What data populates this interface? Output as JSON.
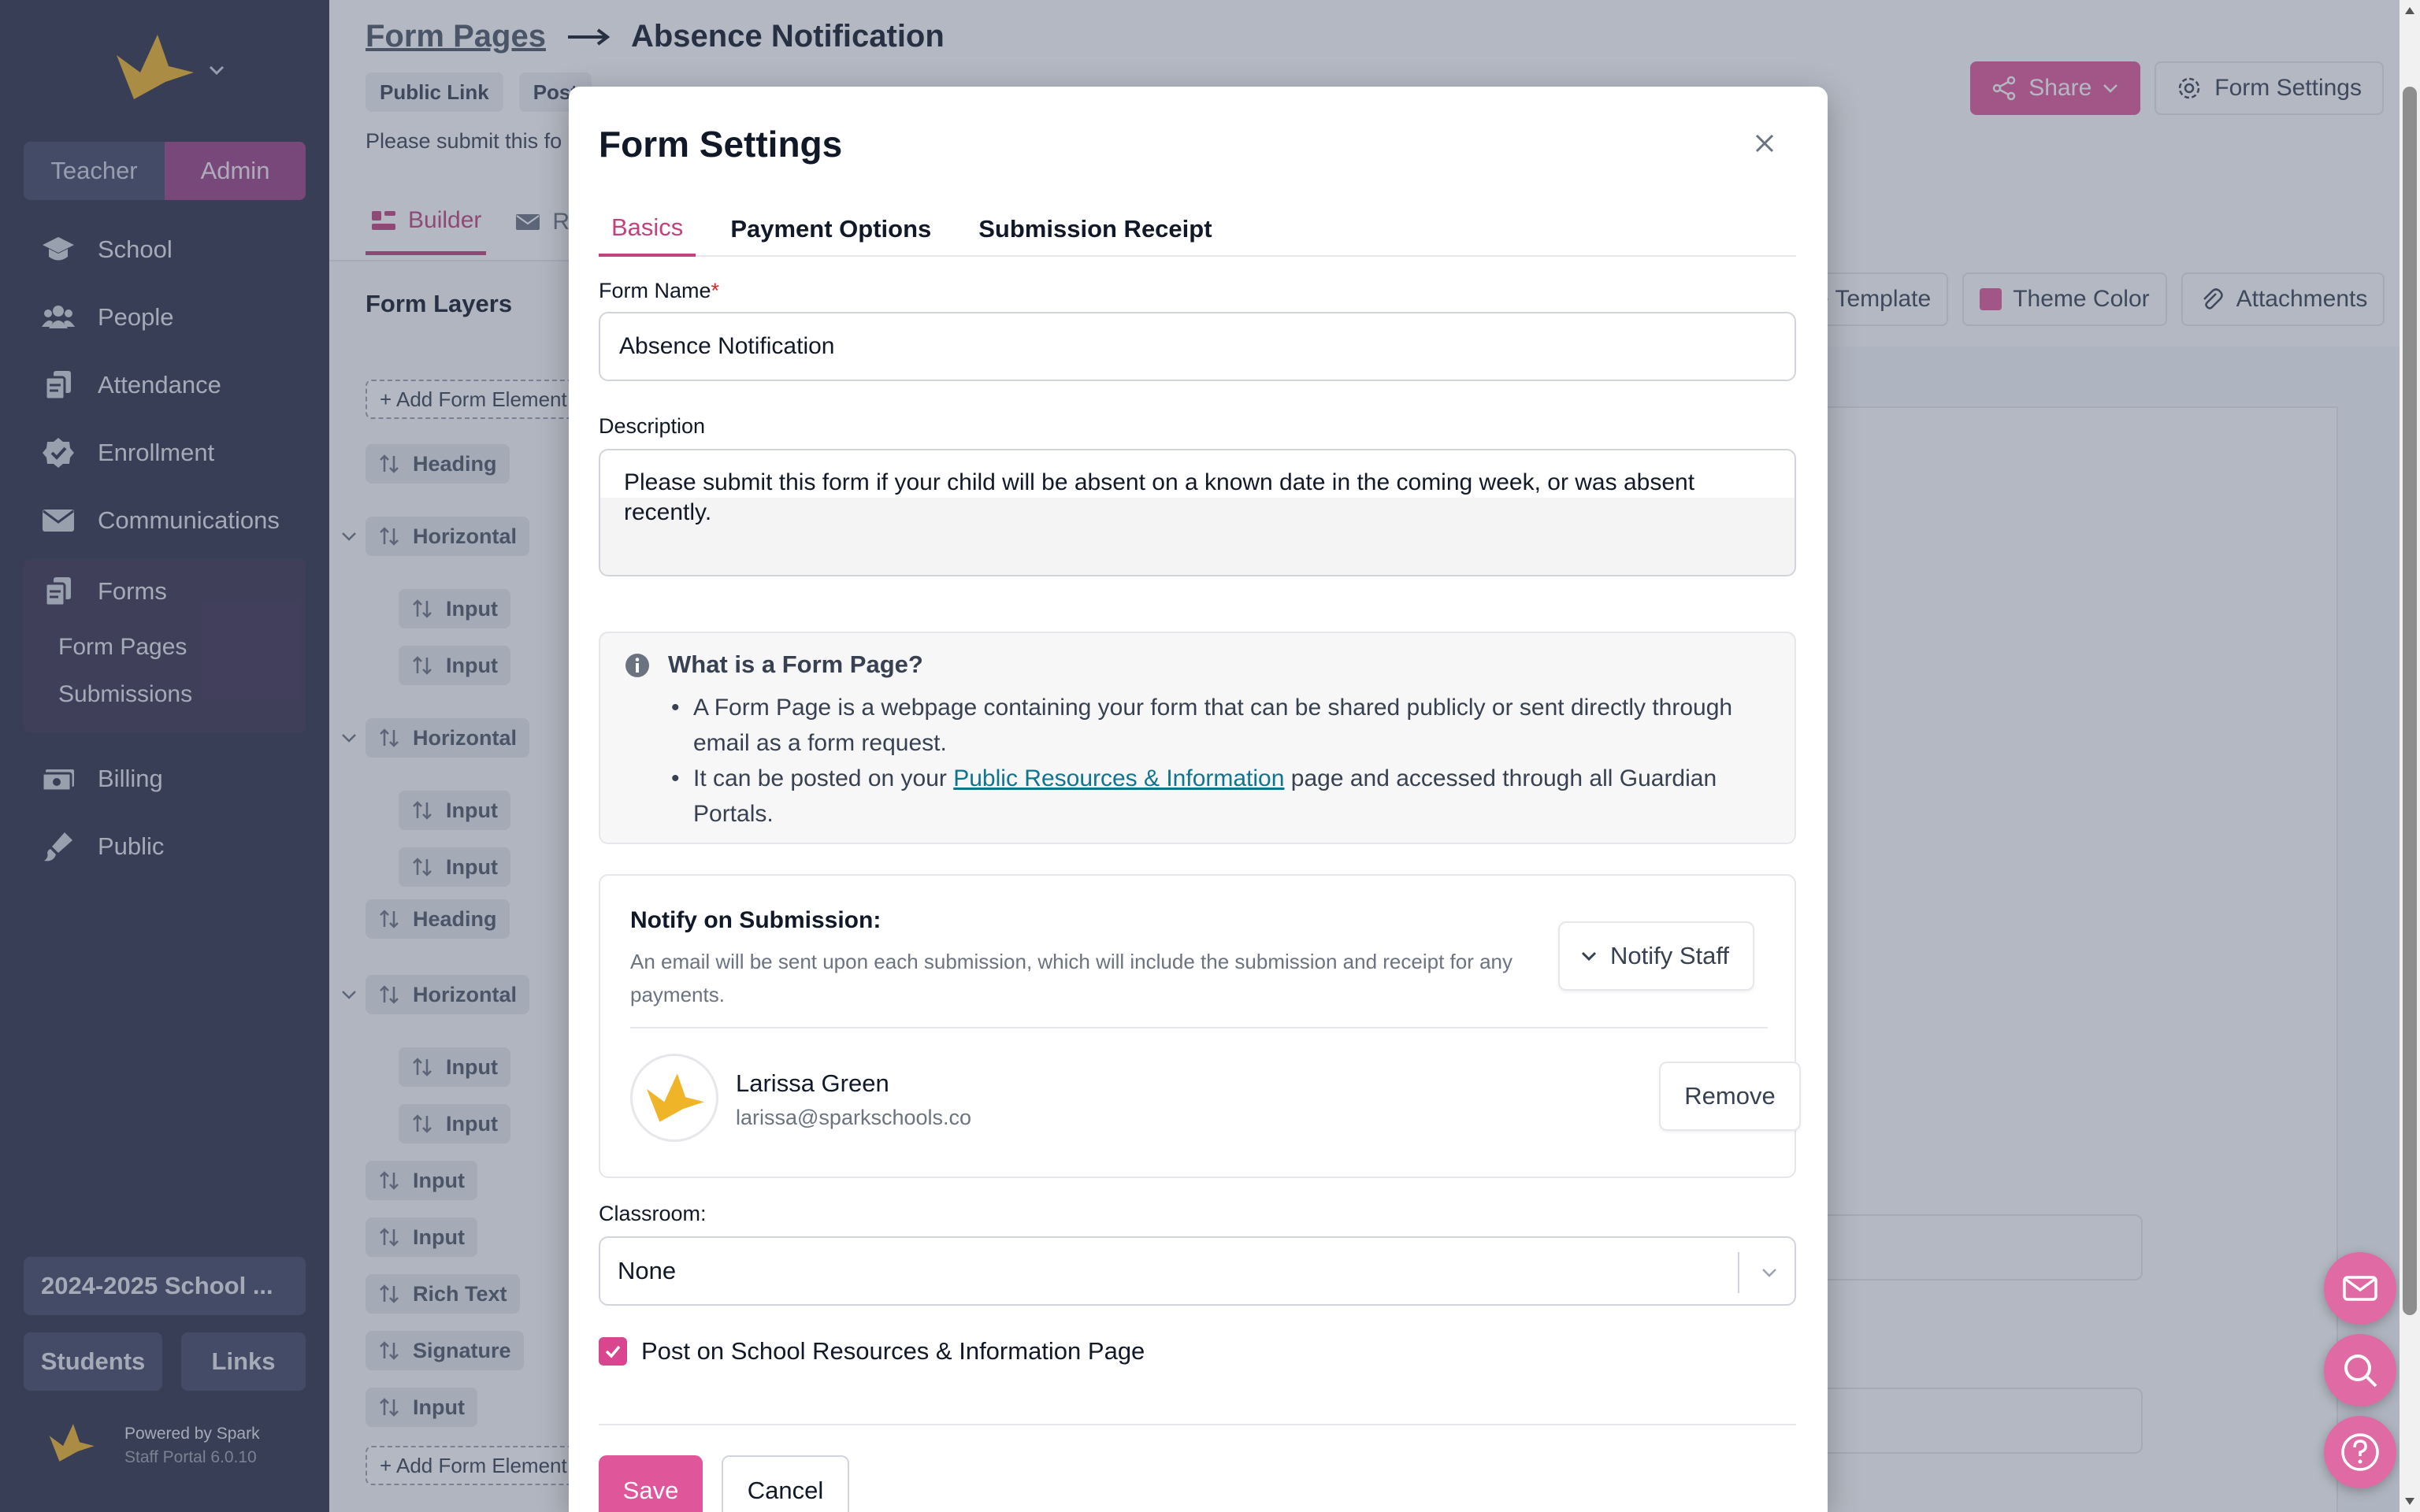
{
  "sidebar": {
    "roles": [
      {
        "label": "Teacher"
      },
      {
        "label": "Admin"
      }
    ],
    "nav": [
      {
        "label": "School",
        "icon": "graduation-cap-icon"
      },
      {
        "label": "People",
        "icon": "users-icon"
      },
      {
        "label": "Attendance",
        "icon": "clipboard-icon"
      },
      {
        "label": "Enrollment",
        "icon": "badge-check-icon"
      },
      {
        "label": "Communications",
        "icon": "envelope-icon"
      }
    ],
    "forms": {
      "label": "Forms",
      "icon": "forms-icon",
      "sub": [
        {
          "label": "Form Pages"
        },
        {
          "label": "Submissions"
        }
      ]
    },
    "nav_after": [
      {
        "label": "Billing",
        "icon": "money-icon"
      },
      {
        "label": "Public",
        "icon": "brush-icon"
      }
    ],
    "school_year": "2024-2025 School ...",
    "students_label": "Students",
    "links_label": "Links",
    "powered_by": "Powered by Spark",
    "version": "Staff Portal 6.0.10"
  },
  "header": {
    "breadcrumb_link": "Form Pages",
    "breadcrumb_current": "Absence Notification",
    "chips": [
      "Public Link",
      "Post"
    ],
    "description_preview": "Please submit this fo",
    "tabs": [
      {
        "label": "Builder",
        "icon": "builder-icon"
      },
      {
        "label": "R",
        "icon": "envelope-icon"
      }
    ],
    "share_label": "Share",
    "form_settings_label": "Form Settings"
  },
  "builder": {
    "layers_title": "Form Layers",
    "add_element_label": "+ Add Form Element",
    "toolbar": {
      "template_label": "ce Template",
      "theme_label": "Theme Color",
      "theme_color": "#e0569a",
      "attachments_label": "Attachments"
    },
    "layers": [
      {
        "label": "Heading"
      },
      {
        "label": "Horizontal"
      },
      {
        "label": "Input"
      },
      {
        "label": "Input"
      },
      {
        "label": "Horizontal"
      },
      {
        "label": "Input"
      },
      {
        "label": "Input"
      },
      {
        "label": "Heading"
      },
      {
        "label": "Horizontal"
      },
      {
        "label": "Input"
      },
      {
        "label": "Input"
      },
      {
        "label": "Input"
      },
      {
        "label": "Input"
      },
      {
        "label": "Rich Text"
      },
      {
        "label": "Signature"
      },
      {
        "label": "Input"
      }
    ]
  },
  "modal": {
    "title": "Form Settings",
    "tabs": [
      {
        "label": "Basics"
      },
      {
        "label": "Payment Options"
      },
      {
        "label": "Submission Receipt"
      }
    ],
    "form_name_label": "Form Name",
    "required_mark": "*",
    "form_name_value": "Absence Notification",
    "description_label": "Description",
    "description_value": "Please submit this form if your child will be absent on a known date in the coming week, or was absent recently.",
    "info": {
      "title": "What is a Form Page?",
      "bullet1": "A Form Page is a webpage containing your form that can be shared publicly or sent directly through email as a form request.",
      "bullet2_before": "It can be posted on your ",
      "bullet2_link": "Public Resources & Information",
      "bullet2_after": " page and accessed through all Guardian Portals."
    },
    "notify": {
      "title": "Notify on Submission:",
      "help": "An email will be sent upon each submission, which will include the submission and receipt for any payments.",
      "button_label": "Notify Staff",
      "staff": {
        "name": "Larissa Green",
        "email": "larissa@sparkschools.co"
      },
      "remove_label": "Remove"
    },
    "classroom_label": "Classroom:",
    "classroom_value": "None",
    "post_checkbox_label": "Post on School Resources & Information Page",
    "post_checked": true,
    "save_label": "Save",
    "cancel_label": "Cancel"
  },
  "colors": {
    "accent": "#e0569a",
    "sidebar_bg": "#2a2d45",
    "brand_logo": "#f0b429"
  }
}
